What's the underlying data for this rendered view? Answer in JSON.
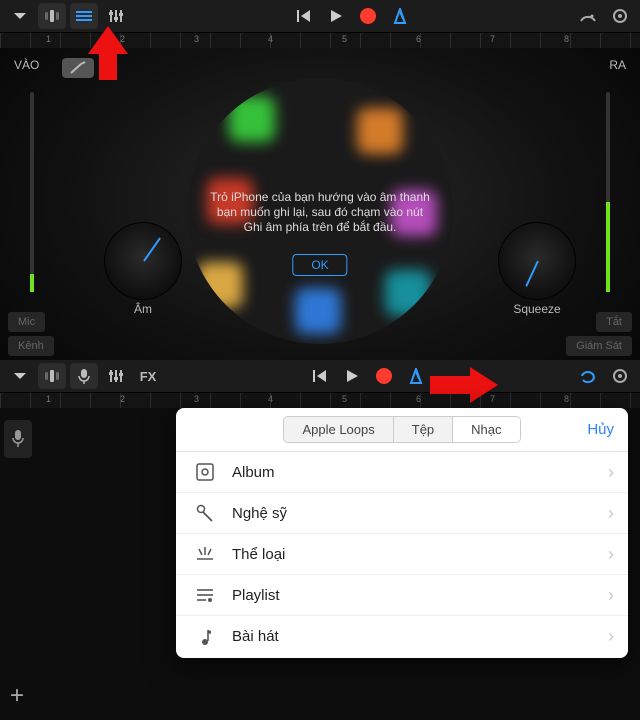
{
  "top_panel": {
    "in_label": "VÀO",
    "out_label": "RA",
    "knob_left": "Âm",
    "knob_right": "Squeeze",
    "mic_btn": "Mic",
    "chan_btn": "Kênh",
    "off_btn": "Tắt",
    "monitor_btn": "Giám Sát",
    "tip": "Trỏ iPhone của bạn hướng vào âm thanh bạn muốn ghi lại, sau đó chạm vào nút Ghi âm phía trên để bắt đầu.",
    "ok": "OK",
    "ruler_numbers": [
      "1",
      "2",
      "3",
      "4",
      "5",
      "6",
      "7",
      "8"
    ]
  },
  "bot_panel": {
    "fx_label": "FX",
    "ruler_numbers": [
      "1",
      "2",
      "3",
      "4",
      "5",
      "6",
      "7",
      "8"
    ]
  },
  "popover": {
    "tabs": {
      "loops": "Apple Loops",
      "files": "Tệp",
      "music": "Nhạc"
    },
    "active_tab": "music",
    "cancel": "Hủy",
    "rows": [
      {
        "name": "album",
        "label": "Album"
      },
      {
        "name": "artist",
        "label": "Nghệ sỹ"
      },
      {
        "name": "genre",
        "label": "Thể loại"
      },
      {
        "name": "playlist",
        "label": "Playlist"
      },
      {
        "name": "song",
        "label": "Bài hát"
      }
    ]
  }
}
